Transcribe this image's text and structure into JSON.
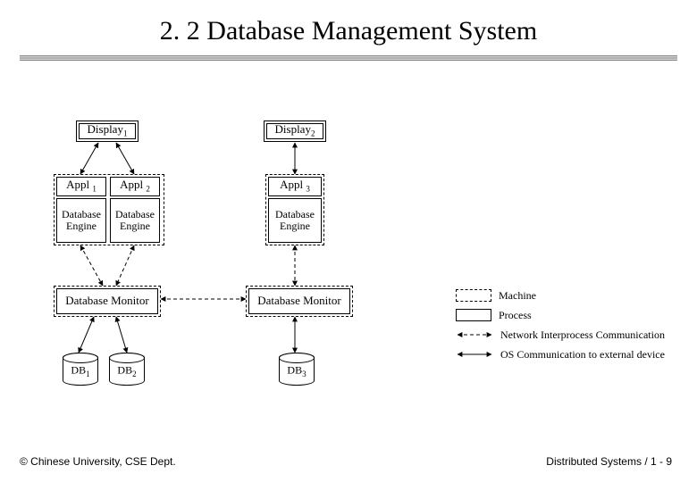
{
  "title": "2. 2 Database Management System",
  "footer_left": "© Chinese University, CSE Dept.",
  "footer_right": "Distributed Systems / 1 - 9",
  "labels": {
    "display1_text": "Display",
    "display1_sub": "1",
    "display2_text": "Display",
    "display2_sub": "2",
    "appl1_text": "Appl",
    "appl1_sub": "1",
    "appl2_text": "Appl",
    "appl2_sub": "2",
    "appl3_text": "Appl",
    "appl3_sub": "3",
    "dbengine": "Database Engine",
    "dbmonitor": "Database Monitor",
    "db1_text": "DB",
    "db1_sub": "1",
    "db2_text": "DB",
    "db2_sub": "2",
    "db3_text": "DB",
    "db3_sub": "3"
  },
  "legend": {
    "machine": "Machine",
    "process": "Process",
    "net_ipc": "Network Interprocess Communication",
    "os_comm": "OS Communication to external device"
  }
}
